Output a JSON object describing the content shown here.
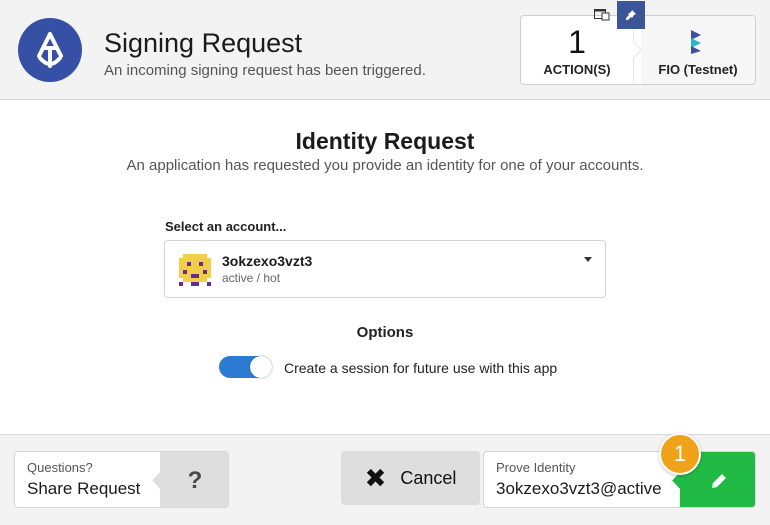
{
  "header": {
    "title": "Signing Request",
    "subtitle": "An incoming signing request has been triggered.",
    "actions_count": "1",
    "actions_label": "ACTION(S)",
    "chain_name": "FIO (Testnet)",
    "icons": {
      "logo": "anchor-logo-icon",
      "window": "window-icon",
      "pin": "pin-icon",
      "chain": "fio-chain-logo-icon"
    },
    "colors": {
      "logo_bg": "#3650a5",
      "pin_bg": "#3b5598",
      "chain_logo": "#3d4fa0"
    }
  },
  "main": {
    "title": "Identity Request",
    "subtitle": "An application has requested you provide an identity for one of your accounts.",
    "select_label": "Select an account...",
    "account": {
      "name": "3okzexo3vzt3",
      "permission": "active / hot"
    },
    "options_title": "Options",
    "session_toggle": {
      "label": "Create a session for future use with this app",
      "enabled": true,
      "color": "#2c7cd3"
    }
  },
  "footer": {
    "questions_small": "Questions?",
    "questions_big": "Share Request",
    "help_glyph": "?",
    "cancel_label": "Cancel",
    "prove_small": "Prove Identity",
    "prove_big": "3okzexo3vzt3@active",
    "colors": {
      "prove_button": "#21ba45"
    }
  },
  "badge": {
    "number": "1",
    "color": "#f0a21b"
  }
}
